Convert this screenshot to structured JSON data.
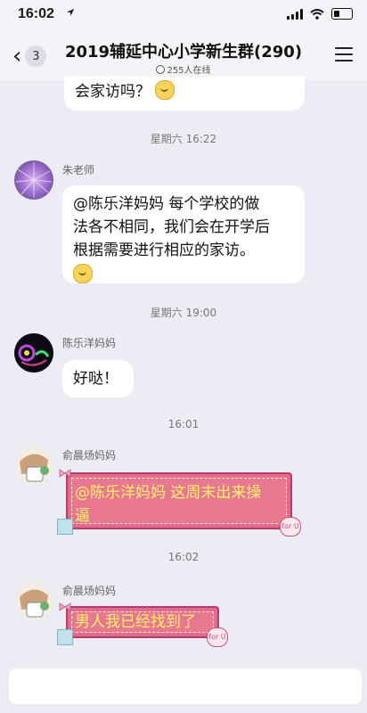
{
  "status_bar": {
    "time": "16:02",
    "location_icon": "location-arrow-icon",
    "icons": [
      "cellular-signal-icon",
      "wifi-icon",
      "battery-icon"
    ]
  },
  "header": {
    "back_icon": "chevron-left-icon",
    "unread_count": "3",
    "title": "2019辅延中心小学新生群(290)",
    "online_text": "255人在线",
    "menu_icon": "hamburger-menu-icon"
  },
  "messages": [
    {
      "type": "bubble_partial",
      "text": "会家访吗？"
    },
    {
      "type": "time",
      "text": "星期六 16:22"
    },
    {
      "type": "message",
      "sender": "朱老师",
      "lines": [
        "@陈乐洋妈妈 每个学校的做",
        "法各不相同，我们会在开学后",
        "根据需要进行相应的家访。"
      ]
    },
    {
      "type": "time",
      "text": "星期六 19:00"
    },
    {
      "type": "message",
      "sender": "陈乐洋妈妈",
      "text": "好哒！"
    },
    {
      "type": "time",
      "text": "16:01"
    },
    {
      "type": "message",
      "sender": "俞晨炀妈妈",
      "text": "@陈乐洋妈妈 这周末出来操",
      "text_cont": "逼"
    },
    {
      "type": "time",
      "text": "16:02"
    },
    {
      "type": "message",
      "sender": "俞晨炀妈妈",
      "text": "男人我已经找到了"
    }
  ],
  "stickers": {
    "heart_tag": "for U"
  },
  "colors": {
    "background": "#ececf4",
    "bubble": "#ffffff",
    "pink_bubble": "#e8788f",
    "pink_text": "#fff36a"
  }
}
